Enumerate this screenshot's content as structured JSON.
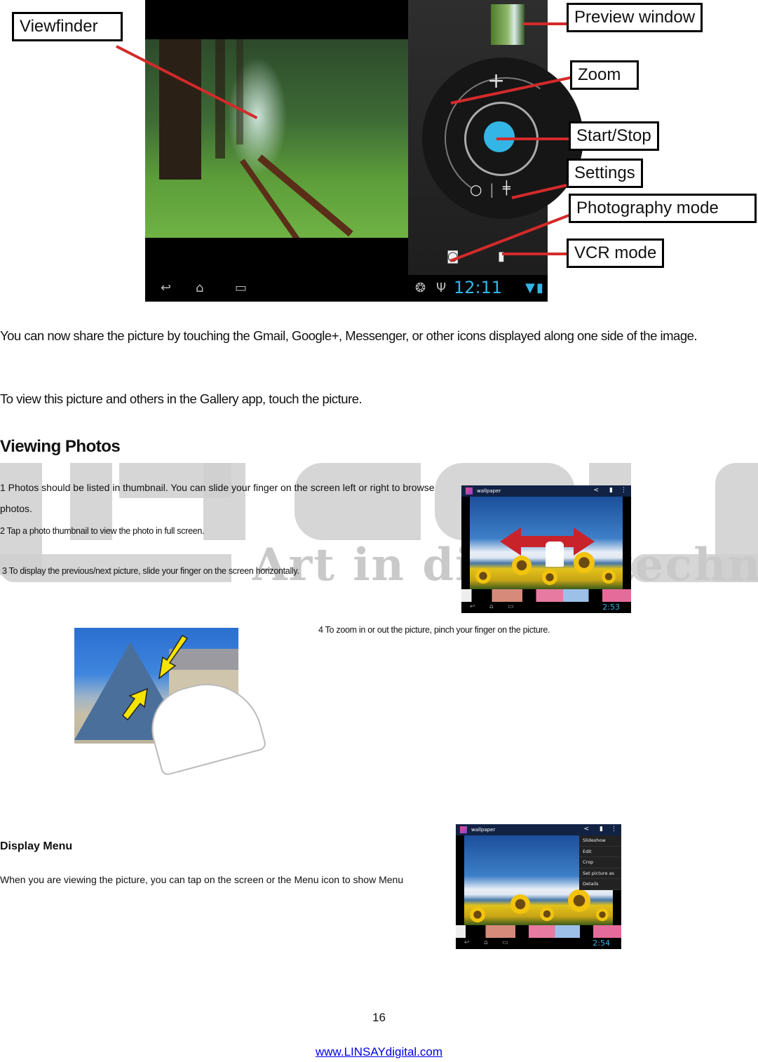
{
  "camera_figure": {
    "callouts": [
      {
        "id": "viewfinder",
        "label": "Viewfinder"
      },
      {
        "id": "preview-window",
        "label": "Preview window"
      },
      {
        "id": "zoom",
        "label": "Zoom"
      },
      {
        "id": "start-stop",
        "label": "Start/Stop"
      },
      {
        "id": "settings",
        "label": "Settings"
      },
      {
        "id": "photography-mode",
        "label": "Photography mode"
      },
      {
        "id": "vcr-mode",
        "label": "VCR mode"
      }
    ],
    "zoom_plus_label": "+",
    "status_clock": "12:11",
    "accent_color": "#33b5e5",
    "leader_color": "#d42a2a"
  },
  "paragraphs": {
    "share": "You can now share the picture by touching the Gmail, Google+, Messenger, or other icons displayed along one side of the image.",
    "gallery": "To view this picture and others in the Gallery app, touch the picture."
  },
  "viewing_photos": {
    "heading": "Viewing Photos",
    "step1": "1 Photos should be listed in thumbnail. You can slide your finger on the screen left or right to browse photos.",
    "step2": "2 Tap a photo thumbnail to view the photo in full screen.",
    "step3": "3 To display the previous/next picture, slide your finger on the screen horizontally.",
    "step4": "4 To zoom in or out the picture, pinch your finger on the picture.",
    "gallery_screenshot": {
      "title": "wallpaper",
      "clock": "2:53"
    }
  },
  "display_menu": {
    "heading": "Display Menu",
    "text": "When you are viewing the picture, you can tap on the screen or the Menu icon to show Menu",
    "gallery_screenshot": {
      "title": "wallpaper",
      "clock": "2:54",
      "menu_items": [
        "Slideshow",
        "Edit",
        "Crop",
        "Set picture as",
        "Details"
      ]
    }
  },
  "watermark": {
    "brand": "LINSAY",
    "tagline": "Art in digital technology"
  },
  "footer": {
    "page_number": "16",
    "website": "www.LINSAYdigital.com"
  }
}
